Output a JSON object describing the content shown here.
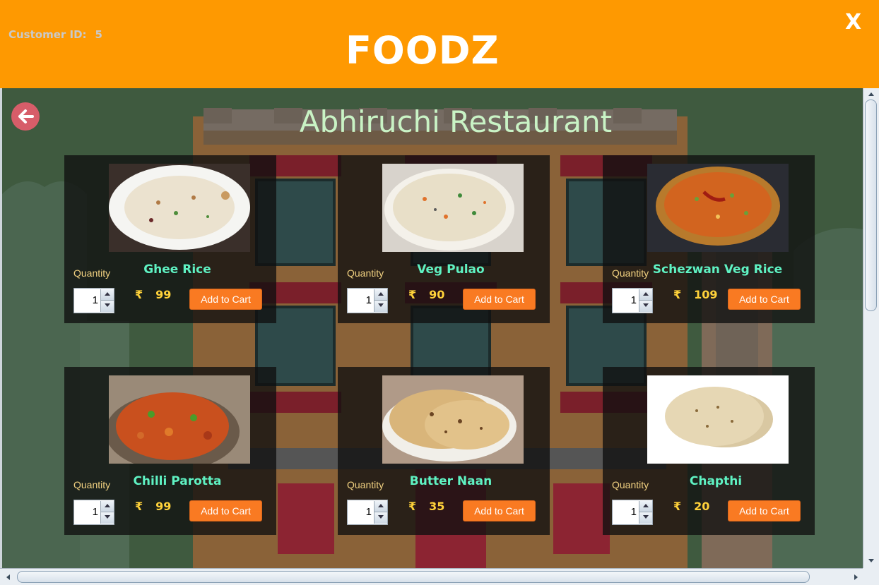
{
  "header": {
    "customer_label": "Customer ID:",
    "customer_id": "5",
    "brand": "FOODZ",
    "close_label": "X"
  },
  "restaurant": {
    "name": "Abhiruchi Restaurant"
  },
  "items": [
    {
      "name": "Ghee Rice",
      "qty_label": "Quantity",
      "qty": "1",
      "currency": "₹",
      "price": "99",
      "button": "Add to Cart"
    },
    {
      "name": "Veg Pulao",
      "qty_label": "Quantity",
      "qty": "1",
      "currency": "₹",
      "price": "90",
      "button": "Add to Cart"
    },
    {
      "name": "Schezwan Veg Rice",
      "qty_label": "Quantity",
      "qty": "1",
      "currency": "₹",
      "price": "109",
      "button": "Add to Cart"
    },
    {
      "name": "Chilli Parotta",
      "qty_label": "Quantity",
      "qty": "1",
      "currency": "₹",
      "price": "99",
      "button": "Add to Cart"
    },
    {
      "name": "Butter Naan",
      "qty_label": "Quantity",
      "qty": "1",
      "currency": "₹",
      "price": "35",
      "button": "Add to Cart"
    },
    {
      "name": "Chapthi",
      "qty_label": "Quantity",
      "qty": "1",
      "currency": "₹",
      "price": "20",
      "button": "Add to Cart"
    }
  ],
  "colors": {
    "header": "#fe9901",
    "button": "#f97a22",
    "dish_name": "#5ff2c3",
    "price": "#ffd23a",
    "title": "#c9f3c5"
  }
}
